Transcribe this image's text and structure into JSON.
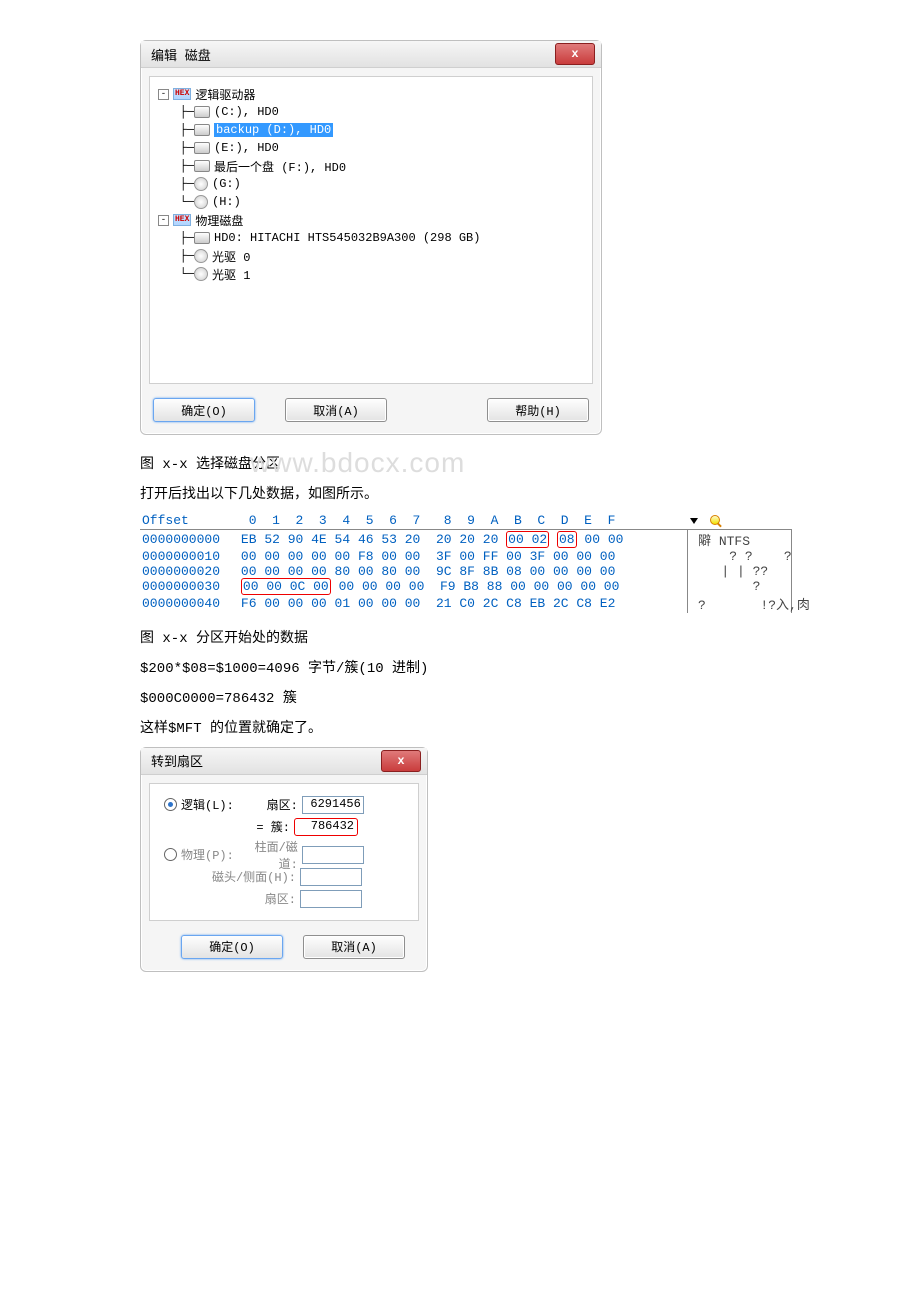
{
  "dialog1": {
    "title": "编辑 磁盘",
    "close_x": "x",
    "tree": {
      "root_logical": "逻辑驱动器",
      "c_drive": "(C:), HD0",
      "d_drive_sel": "backup (D:), HD0",
      "e_drive": "(E:), HD0",
      "f_drive": "最后一个盘 (F:), HD0",
      "g_drive": "(G:)",
      "h_drive": "(H:)",
      "root_physical": "物理磁盘",
      "hd0": "HD0: HITACHI HTS545032B9A300 (298 GB)",
      "opt0": "光驱 0",
      "opt1": "光驱 1"
    },
    "buttons": {
      "ok": "确定(O)",
      "cancel": "取消(A)",
      "help": "帮助(H)"
    }
  },
  "caption1": "图 x-x 选择磁盘分区",
  "text1": "打开后找出以下几处数据，如图所示。",
  "watermark": "www.bdocx.com",
  "hex": {
    "header_offset": "Offset",
    "header_cols": " 0  1  2  3  4  5  6  7   8  9  A  B  C  D  E  F ",
    "rows": [
      {
        "off": "0000000000",
        "b0": "EB 52 90 4E 54 46 53 20  20 20 20 ",
        "b_red1": "00 02",
        "b_mid": "",
        "b_red2": "08",
        "b_end": " 00 00",
        "asc": " 隦 NTFS"
      },
      {
        "off": "0000000010",
        "bytes": "00 00 00 00 00 F8 00 00  3F 00 FF 00 3F 00 00 00",
        "asc": "     ? ?    ?"
      },
      {
        "off": "0000000020",
        "bytes": "00 00 00 00 80 00 80 00  9C 8F 8B 08 00 00 00 00",
        "asc": "    | | ??"
      },
      {
        "off": "0000000030",
        "b_red1": "00 00 0C 00",
        "b_end": "00 00 00 00  F9 B8 88 00 00 00 00 00",
        "asc": "        ?"
      },
      {
        "off": "0000000040",
        "bytes": "F6 00 00 00 01 00 00 00  21 C0 2C C8 EB 2C C8 E2",
        "asc": " ?       !?入,肉"
      }
    ]
  },
  "caption2": "图 x-x 分区开始处的数据",
  "text2": "$200*$08=$1000=4096 字节/簇(10 进制)",
  "text3": "$000C0000=786432 簇",
  "text4": "这样$MFT 的位置就确定了。",
  "dialog2": {
    "title": "转到扇区",
    "close_x": "x",
    "radio_logical": "逻辑(L):",
    "sector_lbl": "扇区:",
    "sector_val": "6291456",
    "cluster_lbl": "= 簇:",
    "cluster_val": "786432",
    "radio_physical": "物理(P):",
    "cyl_lbl": "柱面/磁道:",
    "head_lbl": "磁头/侧面(H):",
    "sect_lbl": "扇区:",
    "ok": "确定(O)",
    "cancel": "取消(A)"
  }
}
